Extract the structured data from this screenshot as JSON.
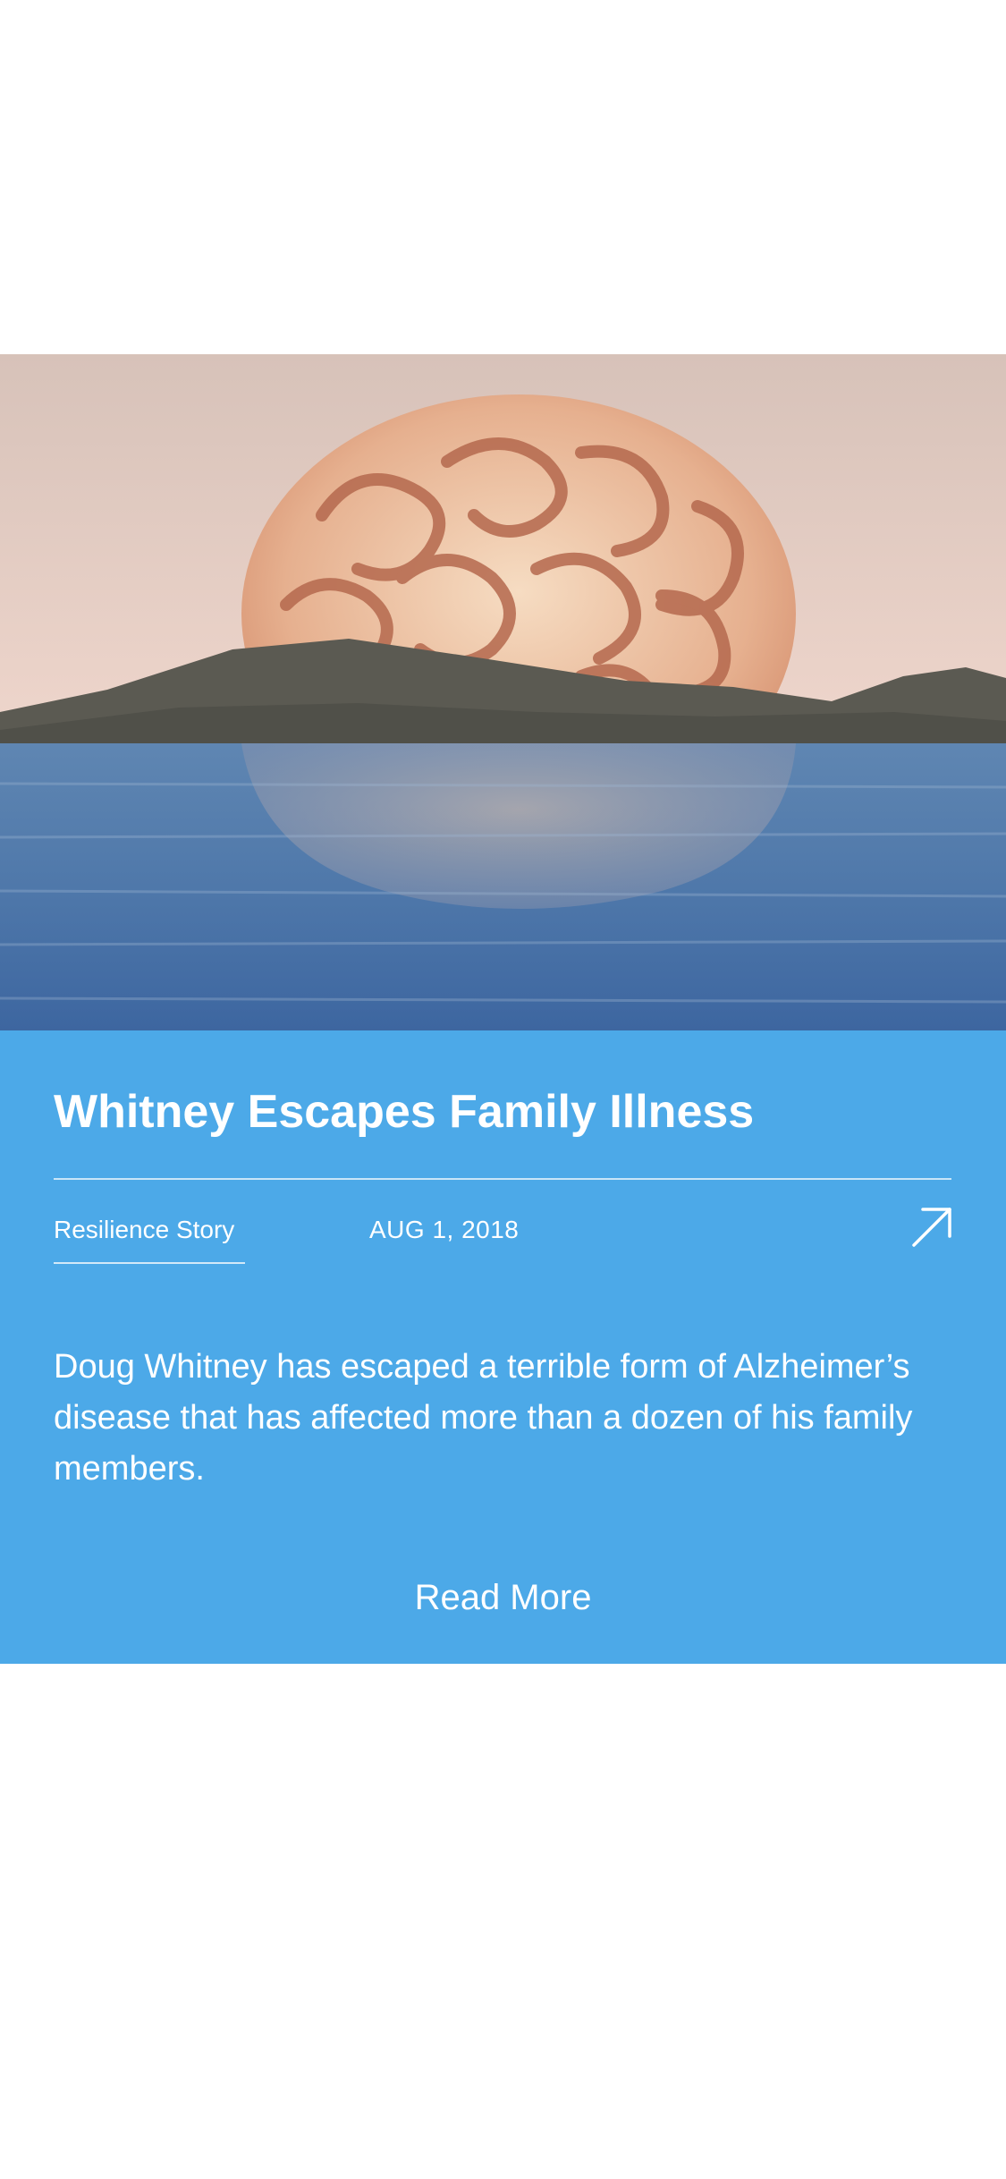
{
  "article": {
    "title": "Whitney Escapes Family Illness",
    "category": "Resilience Story",
    "date": "AUG 1, 2018",
    "summary": "Doug Whitney has escaped a terrible form of Alzheimer’s disease that has affected more than a dozen of his family members.",
    "read_more_label": "Read More",
    "share_icon": "arrow-up-right-icon"
  },
  "hero_image": {
    "subject": "watercolor brain rising over water like a sunset"
  },
  "colors": {
    "card_background": "#4ca9e8",
    "text": "#ffffff",
    "page_background": "#ffffff"
  }
}
